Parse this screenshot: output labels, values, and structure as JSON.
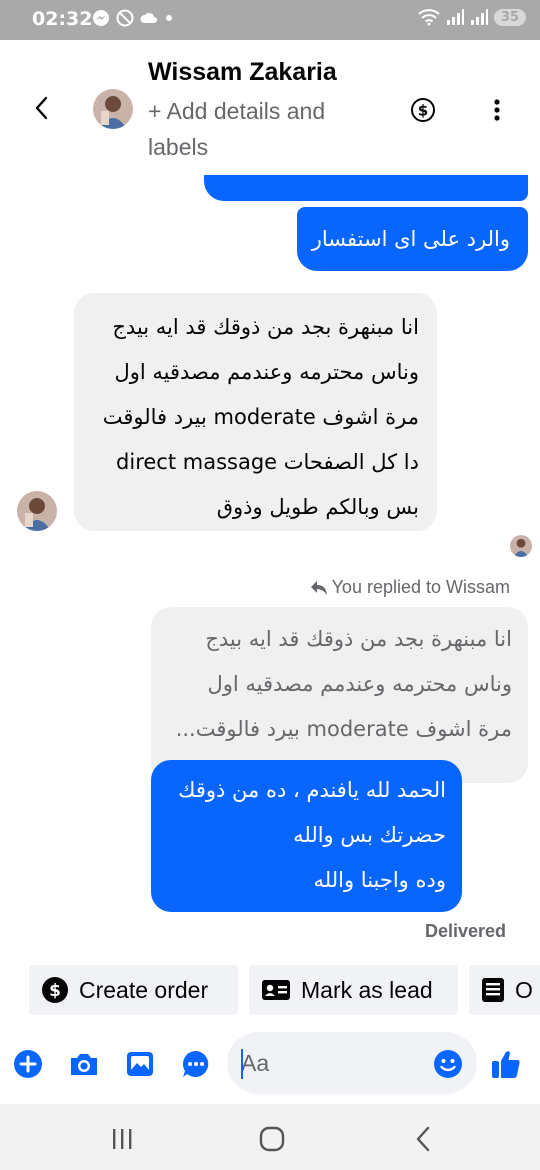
{
  "status_bar": {
    "time": "02:32",
    "battery": "35"
  },
  "header": {
    "contact_name": "Wissam Zakaria",
    "subtitle": "+ Add details and labels"
  },
  "messages": {
    "outgoing_top_partial": "",
    "outgoing_1": "والرد على اى استفسار",
    "incoming_1": [
      "انا مبنهرة بجد من ذوقك قد ايه بيدج",
      "وناس محترمه وعندمم مصدقيه اول",
      "مرة اشوف moderate بيرد فالوقت",
      "دا كل الصفحات direct massage",
      "بس وبالكم طويل وذوق"
    ],
    "replied_label": "You replied to Wissam",
    "quoted": [
      "انا مبنهرة بجد من ذوقك قد ايه بيدج",
      "وناس محترمه وعندمم مصدقيه اول",
      "مرة اشوف moderate بيرد فالوقت..."
    ],
    "reply": [
      "الحمد لله يافندم ، ده من ذوقك",
      "حضرتك بس والله",
      "وده واجبنا والله"
    ],
    "status": "Delivered"
  },
  "quick_actions": {
    "create_order": "Create order",
    "mark_as_lead": "Mark as lead",
    "third_partial": "O"
  },
  "composer": {
    "placeholder": "Aa"
  },
  "colors": {
    "accent": "#0866ff",
    "bubble_in": "#f0f0f0",
    "status_bar": "#a9a9a9"
  },
  "icons": {
    "back": "chevron-left-icon",
    "dollar": "dollar-circle-icon",
    "more": "more-vertical-icon",
    "plus": "plus-circle-icon",
    "camera": "camera-icon",
    "image": "image-icon",
    "sticker": "chat-dots-icon",
    "emoji": "smile-icon",
    "like": "thumbs-up-icon"
  }
}
